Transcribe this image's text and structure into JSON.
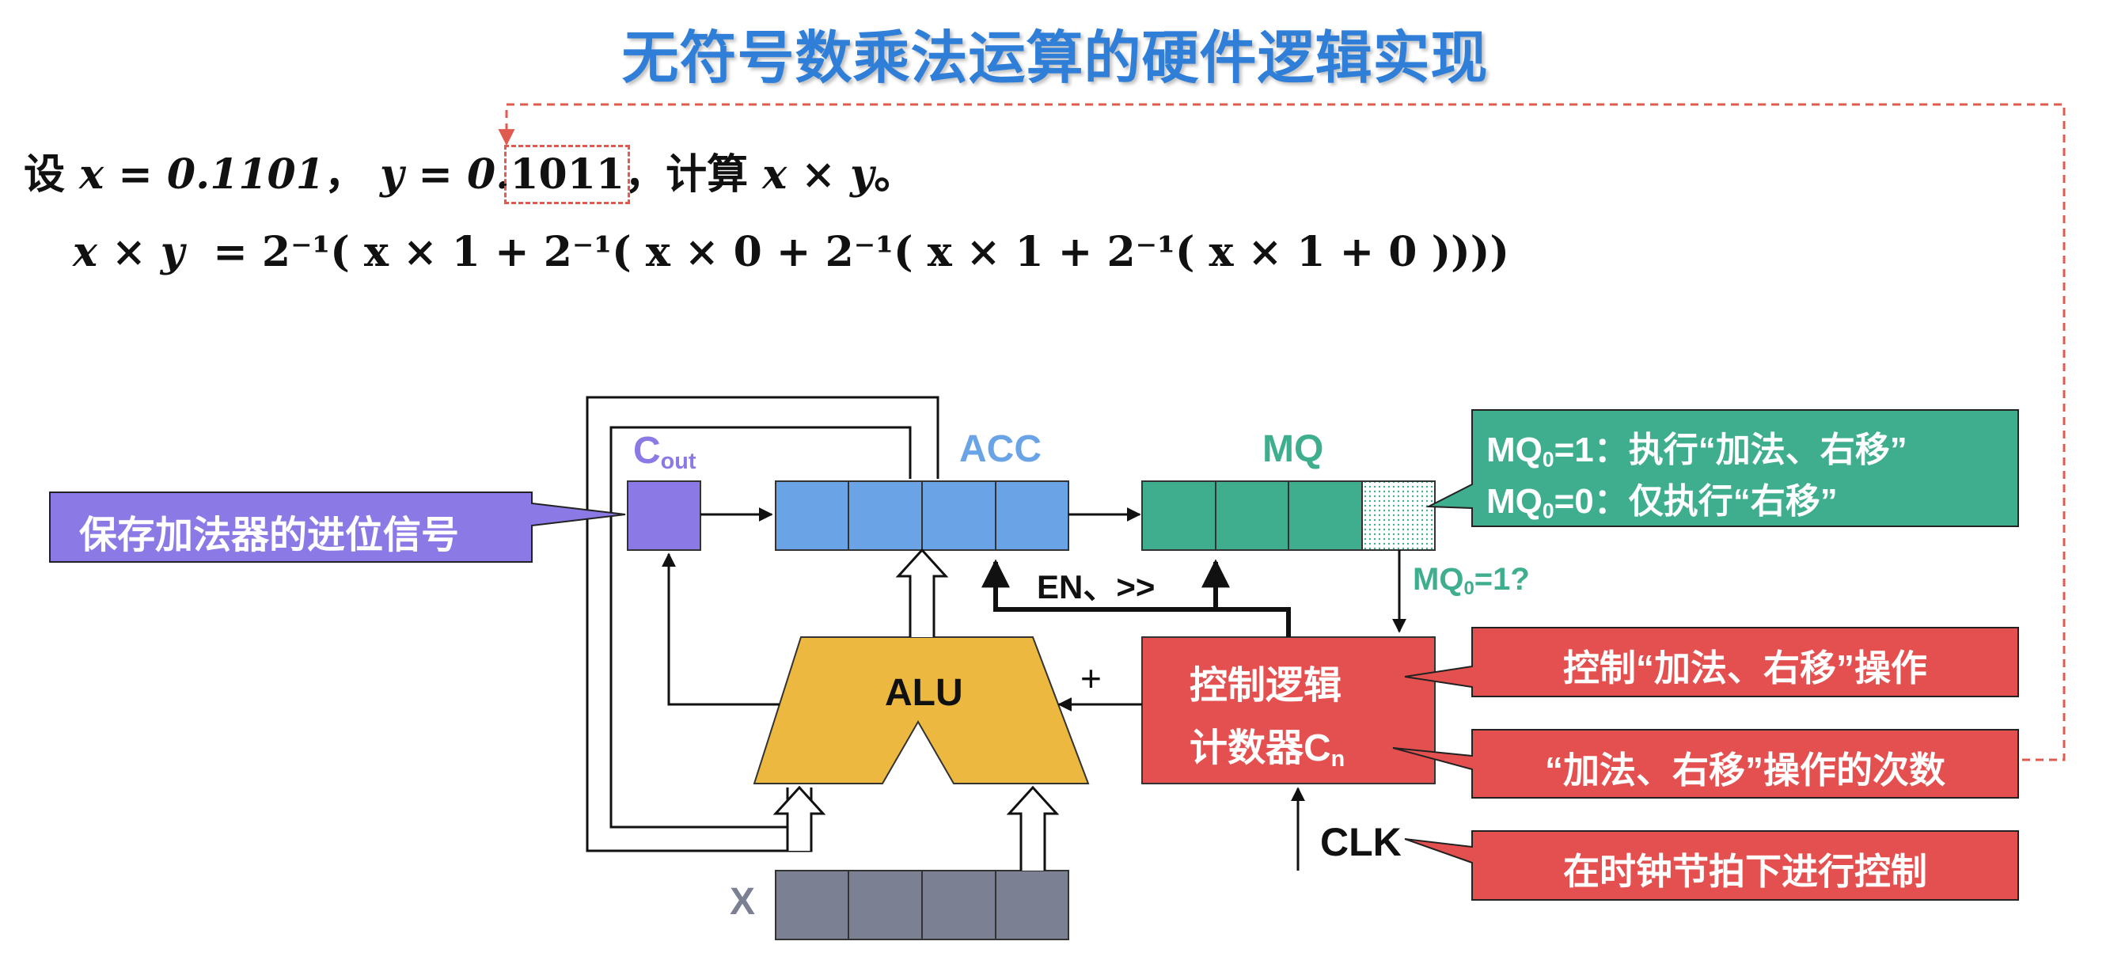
{
  "title": "无符号数乘法运算的硬件逻辑实现",
  "problem": {
    "prefix": "设",
    "x_eq": "x = 0.1101",
    "sep1": "，",
    "y_eq_head": "y = 0.",
    "y_digits": "1011",
    "sep2": "，",
    "compute": "计算",
    "expr": "x × y",
    "end": "。"
  },
  "equation": {
    "lhs": "x × y",
    "rhs": "= 2⁻¹( x × 1 + 2⁻¹( x × 0 + 2⁻¹( x × 1 + 2⁻¹( x × 1 + 0 ))))"
  },
  "diagram": {
    "cout_main": "C",
    "cout_sub": "out",
    "acc": "ACC",
    "mq": "MQ",
    "alu": "ALU",
    "x_reg": "X",
    "en_label": "EN、>>",
    "mq_test_main": "MQ",
    "mq_test_sub": "0",
    "mq_test_rest": "=1?",
    "plus": "+",
    "clk": "CLK",
    "control_line1": "控制逻辑",
    "control_line2_main": "计数器C",
    "control_line2_sub": "n"
  },
  "callouts": {
    "carry": "保存加法器的进位信号",
    "mq_rule1_main": "MQ",
    "mq_rule1_sub": "0",
    "mq_rule1_rest": "=1：执行“加法、右移”",
    "mq_rule2_main": "MQ",
    "mq_rule2_sub": "0",
    "mq_rule2_rest": "=0：仅执行“右移”",
    "control_op": "控制“加法、右移”操作",
    "count": "“加法、右移”操作的次数",
    "clock": "在时钟节拍下进行控制"
  },
  "colors": {
    "title": "#2f7fd8",
    "cout": "#8b79e6",
    "acc": "#6ba4e6",
    "mq": "#3fae8f",
    "alu": "#ecb83f",
    "x_reg": "#7b8192",
    "control": "#e3504f",
    "carry_callout": "#8b79e6",
    "mq_callout": "#3fae8f",
    "red_callout": "#e3504f"
  }
}
